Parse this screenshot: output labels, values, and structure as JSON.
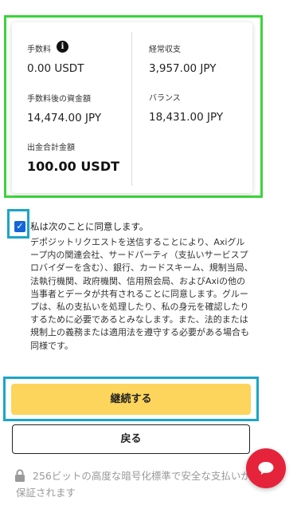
{
  "summary": {
    "fee_label": "手数料",
    "fee_info_icon": "info-icon",
    "fee_value": "0.00 USDT",
    "funds_after_fee_label": "手数料後の資金額",
    "funds_after_fee_value": "14,474.00 JPY",
    "withdrawal_total_label": "出金合計金額",
    "withdrawal_total_value": "100.00 USDT",
    "pnl_label": "経常収支",
    "pnl_value": "3,957.00 JPY",
    "balance_label": "バランス",
    "balance_value": "18,431.00 JPY"
  },
  "agreement": {
    "checked": true,
    "title": "私は次のことに同意します。",
    "text": "デポジットリクエストを送信することにより、Axiグループ内の関連会社、サードパーティ（支払いサービスプロバイダーを含む）、銀行、カードスキーム、規制当局、法執行機関、政府機関、信用照会局、およびAxiの他の当事者とデータが共有されることに同意します。グループは、私の支払いを処理したり、私の身元を確認したりするために必要であるとみなします。また、法的または規制上の義務または適用法を遵守する必要がある場合も同様です。"
  },
  "buttons": {
    "continue_label": "継続する",
    "back_label": "戻る"
  },
  "security": {
    "icon": "lock-icon",
    "text": "256ビットの高度な暗号化標準で安全な支払いが保証されます"
  },
  "chat": {
    "icon": "chat-icon"
  },
  "colors": {
    "primary_button": "#fdd55c",
    "chat_button": "#e5243b",
    "checkbox": "#1565d8"
  }
}
